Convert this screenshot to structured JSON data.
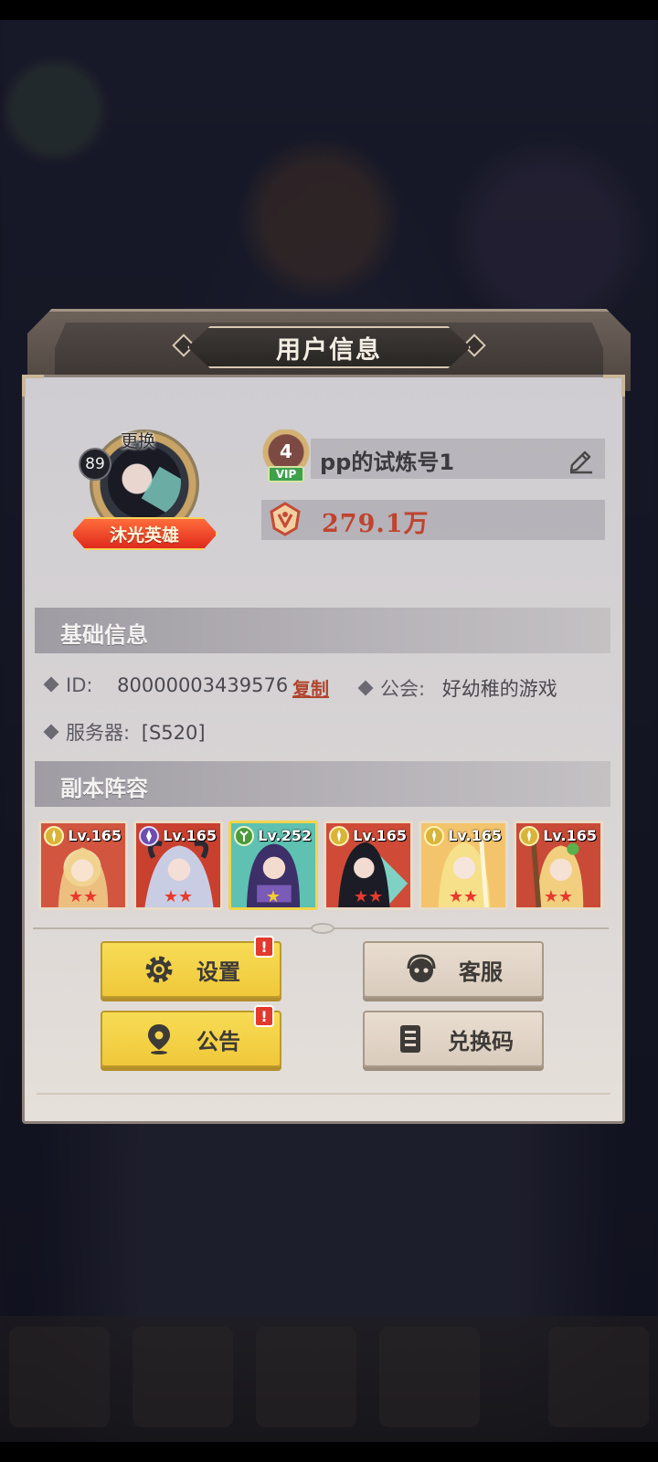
{
  "dialog": {
    "title": "用户信息"
  },
  "profile": {
    "avatar_change_label": "更换",
    "level": "89",
    "hero_title": "沐光英雄",
    "vip_level": "4",
    "vip_label": "VIP",
    "name": "pp的试炼号1",
    "power": "279.1万"
  },
  "basic_info": {
    "header": "基础信息",
    "id_label": "ID:",
    "id_value": "80000003439576",
    "copy_label": "复制",
    "guild_label": "公会:",
    "guild_value": "好幼稚的游戏",
    "server_label": "服务器:",
    "server_value": "[S520]"
  },
  "lineup": {
    "header": "副本阵容",
    "heroes": [
      {
        "level": "Lv.165",
        "stars": "★★",
        "element": "holy"
      },
      {
        "level": "Lv.165",
        "stars": "★★",
        "element": "dark"
      },
      {
        "level": "Lv.252",
        "stars": "★",
        "element": "nature"
      },
      {
        "level": "Lv.165",
        "stars": "★★",
        "element": "holy"
      },
      {
        "level": "Lv.165",
        "stars": "★★",
        "element": "holy"
      },
      {
        "level": "Lv.165",
        "stars": "★★",
        "element": "holy"
      }
    ]
  },
  "buttons": {
    "settings": "设置",
    "support": "客服",
    "announcement": "公告",
    "redeem": "兑换码",
    "alert_mark": "!"
  },
  "colors": {
    "button_yellow": "#f0c83a",
    "button_tan": "#d9ccbd",
    "power_red": "#c0432f",
    "alert_red": "#e23a2d"
  }
}
